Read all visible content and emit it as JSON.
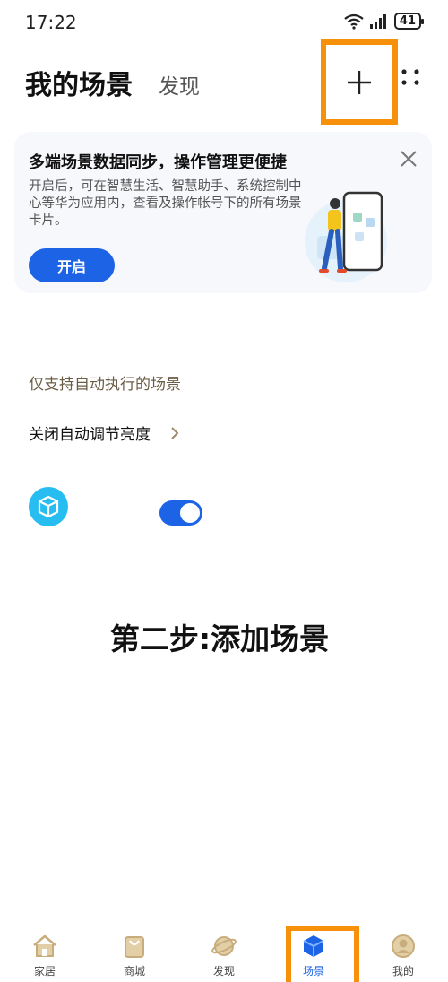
{
  "status_bar": {
    "time": "17:22",
    "battery": "41"
  },
  "header": {
    "title": "我的场景",
    "tab_discover": "发现"
  },
  "promo": {
    "title": "多端场景数据同步，操作管理更便捷",
    "description": "开启后，可在智慧生活、智慧助手、系统控制中心等华为应用内，查看及操作帐号下的所有场景卡片。",
    "button_label": "开启"
  },
  "section": {
    "label": "仅支持自动执行的场景"
  },
  "scene": {
    "name": "关闭自动调节亮度",
    "enabled": true
  },
  "step_caption": "第二步:添加场景",
  "nav": {
    "items": [
      {
        "label": "家居",
        "icon": "home-icon"
      },
      {
        "label": "商城",
        "icon": "shopping-bag-icon"
      },
      {
        "label": "发现",
        "icon": "planet-icon"
      },
      {
        "label": "场景",
        "icon": "cube-icon"
      },
      {
        "label": "我的",
        "icon": "profile-icon"
      }
    ],
    "active_index": 3
  },
  "colors": {
    "accent": "#1c63e6",
    "highlight": "#f7900a",
    "scene_icon_bg": "#28bdf0"
  }
}
